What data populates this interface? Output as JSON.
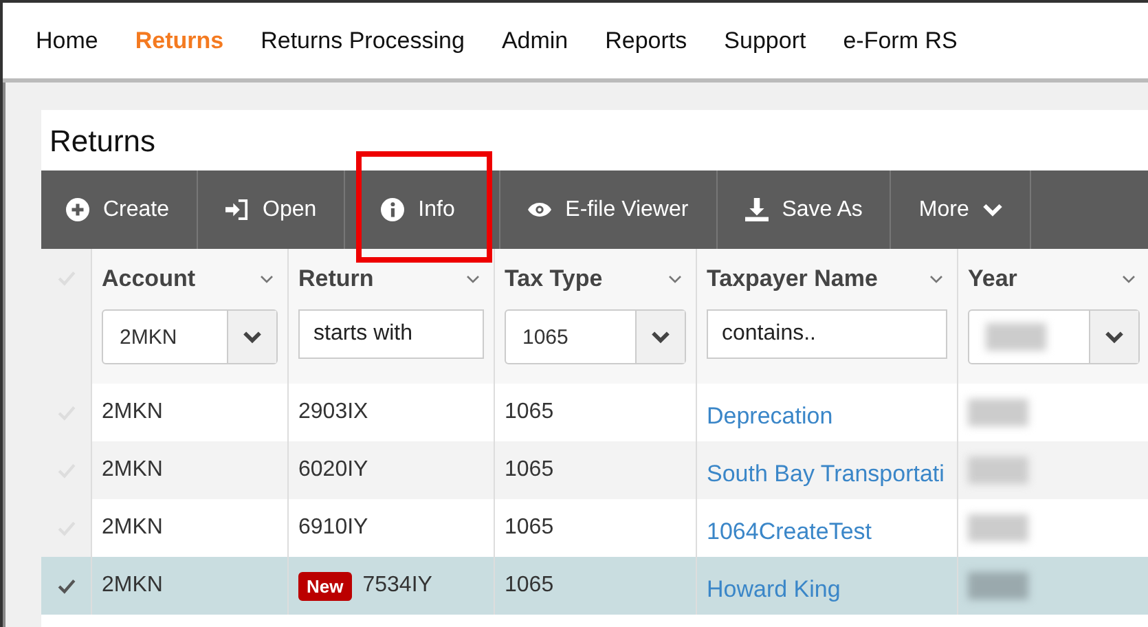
{
  "nav": [
    {
      "label": "Home",
      "selected": false
    },
    {
      "label": "Returns",
      "selected": true
    },
    {
      "label": "Returns Processing",
      "selected": false
    },
    {
      "label": "Admin",
      "selected": false
    },
    {
      "label": "Reports",
      "selected": false
    },
    {
      "label": "Support",
      "selected": false
    },
    {
      "label": "e-Form RS",
      "selected": false
    }
  ],
  "page_title": "Returns",
  "toolbar": [
    {
      "label": "Create",
      "kind": "create",
      "highlighted": false
    },
    {
      "label": "Open",
      "kind": "open",
      "highlighted": false
    },
    {
      "label": "Info",
      "kind": "info",
      "highlighted": true
    },
    {
      "label": "E-file Viewer",
      "kind": "view",
      "highlighted": false
    },
    {
      "label": "Save As",
      "kind": "download",
      "highlighted": false
    },
    {
      "label": "More",
      "kind": "more",
      "highlighted": false
    }
  ],
  "columns": [
    {
      "label": "Account",
      "filter": {
        "kind": "select",
        "value": "2MKN"
      }
    },
    {
      "label": "Return",
      "filter": {
        "kind": "text",
        "placeholder": "starts with"
      }
    },
    {
      "label": "Tax Type",
      "filter": {
        "kind": "select",
        "value": "1065"
      }
    },
    {
      "label": "Taxpayer Name",
      "filter": {
        "kind": "text",
        "placeholder": "contains.."
      }
    },
    {
      "label": "Year",
      "filter": {
        "kind": "select-redacted"
      }
    }
  ],
  "rows": [
    {
      "selected": false,
      "account": "2MKN",
      "return": "2903IX",
      "badge": null,
      "tax_type": "1065",
      "taxpayer": "Deprecation"
    },
    {
      "selected": false,
      "account": "2MKN",
      "return": "6020IY",
      "badge": null,
      "tax_type": "1065",
      "taxpayer": "South Bay Transportati"
    },
    {
      "selected": false,
      "account": "2MKN",
      "return": "6910IY",
      "badge": null,
      "tax_type": "1065",
      "taxpayer": "1064CreateTest"
    },
    {
      "selected": true,
      "account": "2MKN",
      "return": "7534IY",
      "badge": "New",
      "tax_type": "1065",
      "taxpayer": "Howard King"
    }
  ]
}
